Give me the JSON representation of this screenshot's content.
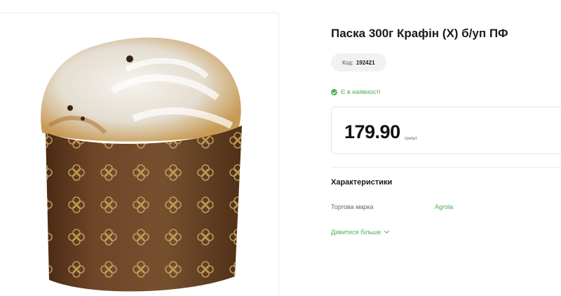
{
  "product": {
    "title": "Паска 300г Крафін (Х) б/уп ПФ",
    "code_label": "Код:",
    "code_value": "192421",
    "stock_status": "Є в наявності",
    "price": "179.90",
    "price_unit": "грн/шт",
    "image_alt": "Паска"
  },
  "characteristics": {
    "title": "Характеристики",
    "items": [
      {
        "label": "Торгова марка",
        "value": "Agrola"
      }
    ],
    "see_more": "Дивитися більше"
  },
  "colors": {
    "accent": "#4caf50",
    "paper": "#6b4226",
    "flower": "#c9a35a"
  }
}
